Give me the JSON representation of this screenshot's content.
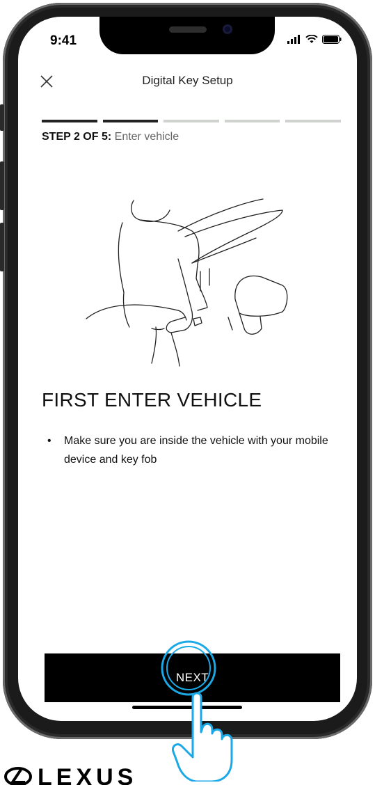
{
  "status_bar": {
    "time": "9:41"
  },
  "header": {
    "title": "Digital Key Setup"
  },
  "progress": {
    "total_steps": 5,
    "current_step": 2
  },
  "step": {
    "label": "STEP 2 OF 5:",
    "description": "Enter vehicle"
  },
  "content": {
    "heading": "FIRST ENTER VEHICLE",
    "bullets": [
      "Make sure you are inside the vehicle with your mobile device and key fob"
    ]
  },
  "footer": {
    "next_label": "NEXT"
  },
  "colors": {
    "accent_tap": "#1aa9e6",
    "button": "#000000",
    "progress_done": "#222222",
    "progress_todo": "#cfd2cf"
  },
  "logo": {
    "text": "LEXUS"
  }
}
